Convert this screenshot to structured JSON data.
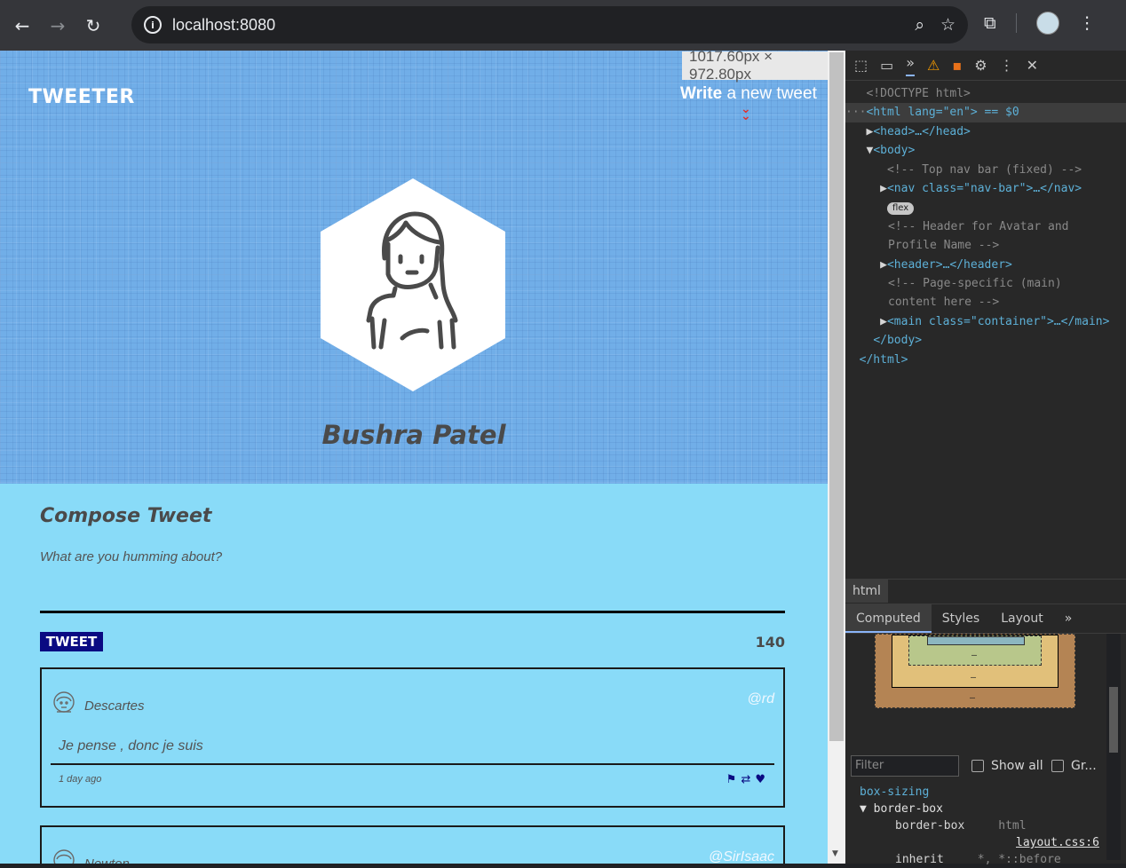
{
  "browser": {
    "url": "localhost:8080"
  },
  "page": {
    "logo": "TWEETER",
    "write_link_bold": "Write",
    "write_link_rest": " a new tweet",
    "dimensions_tooltip": "1017.60px × 972.80px",
    "profile_name": "Bushra Patel",
    "compose_title": "Compose Tweet",
    "compose_placeholder": "What are you humming about?",
    "tweet_button": "TWEET",
    "char_counter": "140",
    "tweets": [
      {
        "name": "Descartes",
        "handle": "@rd",
        "content": "Je pense , donc je suis",
        "time_ago": "1 day ago"
      },
      {
        "name": "Newton",
        "handle": "@SirIsaac"
      }
    ],
    "colors": {
      "header_bg": "#71aee8",
      "body_bg": "#89dbf8",
      "tweet_button_bg": "#0a0a82",
      "chevron": "#dd3333"
    }
  },
  "devtools": {
    "dom_lines": [
      "<!DOCTYPE html>",
      "<html lang=\"en\"> == $0",
      "<head>…</head>",
      "<body>",
      "<!-- Top nav bar (fixed) -->",
      "<nav class=\"nav-bar\">…</nav>",
      "flex",
      "<!-- Header for Avatar and Profile Name -->",
      "<header>…</header>",
      "<!-- Page-specific (main) content here -->",
      "<main class=\"container\">…</main>",
      "</body>",
      "</html>"
    ],
    "breadcrumb": "html",
    "tabs": [
      "Computed",
      "Styles",
      "Layout",
      "»"
    ],
    "filter_placeholder": "Filter",
    "show_all": "Show all",
    "group": "Gr...",
    "computed_prop": "box-sizing",
    "computed_value": "border-box",
    "computed_sub_value": "border-box",
    "computed_sub_source": "html",
    "computed_link": "layout.css:6",
    "computed_next": "inherit",
    "computed_next_src": "*, *::before"
  }
}
